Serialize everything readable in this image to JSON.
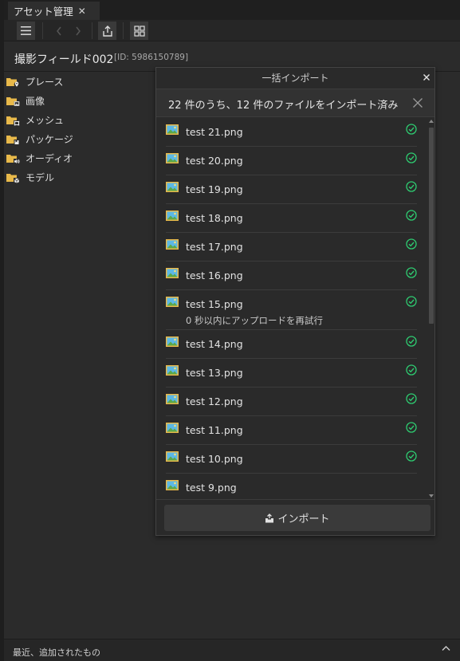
{
  "tab": {
    "label": "アセット管理",
    "close": "✕"
  },
  "header": {
    "title": "撮影フィールド002",
    "id_text": "[ID: 5986150789]"
  },
  "sidebar": {
    "items": [
      {
        "label": "プレース",
        "icon": "place-folder-icon"
      },
      {
        "label": "画像",
        "icon": "image-folder-icon"
      },
      {
        "label": "メッシュ",
        "icon": "mesh-folder-icon"
      },
      {
        "label": "パッケージ",
        "icon": "package-folder-icon"
      },
      {
        "label": "オーディオ",
        "icon": "audio-folder-icon"
      },
      {
        "label": "モデル",
        "icon": "model-folder-icon"
      }
    ]
  },
  "footer": {
    "label": "最近、追加されたもの"
  },
  "dialog": {
    "title": "一括インポート",
    "status": "22 件のうち、12 件のファイルをインポート済み",
    "import_button": "インポート",
    "files": [
      {
        "name": "test 21.png",
        "status": "done"
      },
      {
        "name": "test 20.png",
        "status": "done"
      },
      {
        "name": "test 19.png",
        "status": "done"
      },
      {
        "name": "test 18.png",
        "status": "done"
      },
      {
        "name": "test 17.png",
        "status": "done"
      },
      {
        "name": "test 16.png",
        "status": "done"
      },
      {
        "name": "test 15.png",
        "status": "done",
        "note": "0 秒以内にアップロードを再試行"
      },
      {
        "name": "test 14.png",
        "status": "done"
      },
      {
        "name": "test 13.png",
        "status": "done"
      },
      {
        "name": "test 12.png",
        "status": "done"
      },
      {
        "name": "test 11.png",
        "status": "done"
      },
      {
        "name": "test 10.png",
        "status": "done"
      },
      {
        "name": "test 9.png",
        "status": "pending"
      }
    ]
  },
  "colors": {
    "check_green": "#2ecc71",
    "folder_yellow": "#e8b94a"
  }
}
